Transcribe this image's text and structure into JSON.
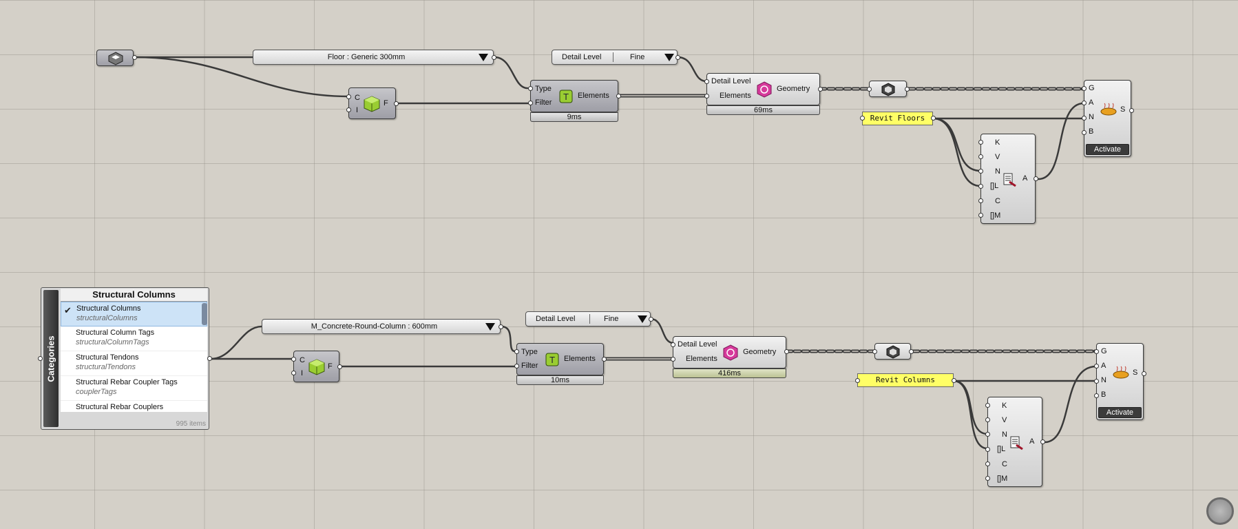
{
  "canvas": {
    "top_group": {
      "floor_type_value": "Floor : Generic 300mm",
      "detail_level": {
        "label": "Detail Level",
        "value": "Fine"
      },
      "filter_component": {
        "in_c": "C",
        "in_i": "I",
        "out_f": "F"
      },
      "query_component": {
        "in_type": "Type",
        "in_filter": "Filter",
        "out": "Elements",
        "timer": "9ms"
      },
      "geometry_component": {
        "in_detail": "Detail Level",
        "in_elements": "Elements",
        "out": "Geometry",
        "timer": "69ms"
      },
      "panel_text": "Revit Floors",
      "attr_component": {
        "inputs": [
          "K",
          "V",
          "N",
          "[]L",
          "C",
          "[]M"
        ],
        "out": "A"
      },
      "bake_component": {
        "inputs": [
          "G",
          "A",
          "N",
          "B"
        ],
        "out": "S",
        "button": "Activate"
      }
    },
    "bottom_group": {
      "column_type_value": "M_Concrete-Round-Column : 600mm",
      "detail_level": {
        "label": "Detail Level",
        "value": "Fine"
      },
      "filter_component": {
        "in_c": "C",
        "in_i": "I",
        "out_f": "F"
      },
      "query_component": {
        "in_type": "Type",
        "in_filter": "Filter",
        "out": "Elements",
        "timer": "10ms"
      },
      "geometry_component": {
        "in_detail": "Detail Level",
        "in_elements": "Elements",
        "out": "Geometry",
        "timer": "416ms"
      },
      "panel_text": "Revit Columns",
      "attr_component": {
        "inputs": [
          "K",
          "V",
          "N",
          "[]L",
          "C",
          "[]M"
        ],
        "out": "A"
      },
      "bake_component": {
        "inputs": [
          "G",
          "A",
          "N",
          "B"
        ],
        "out": "S",
        "button": "Activate"
      }
    },
    "categories_picker": {
      "side_label": "Categories",
      "title": "Structural Columns",
      "items": [
        {
          "name": "Structural Columns",
          "sub": "structuralColumns",
          "selected": true
        },
        {
          "name": "Structural Column Tags",
          "sub": "structuralColumnTags",
          "selected": false
        },
        {
          "name": "Structural Tendons",
          "sub": "structuralTendons",
          "selected": false
        },
        {
          "name": "Structural Rebar Coupler Tags",
          "sub": "couplerTags",
          "selected": false
        },
        {
          "name": "Structural Rebar Couplers",
          "sub": "",
          "selected": false
        }
      ],
      "count": "995 items"
    }
  },
  "colors": {
    "canvas": "#d4d0c8",
    "panel": "#ffff66",
    "geometry_icon": "#d63a9b",
    "component_icon": "#9acd32"
  },
  "icons": {
    "category_param": "category-param-icon",
    "filter": "category-filter-icon",
    "query": "query-elements-icon",
    "geometry": "element-geometry-icon",
    "data": "data-param-icon",
    "attr": "attributes-icon",
    "bake": "bake-icon"
  }
}
